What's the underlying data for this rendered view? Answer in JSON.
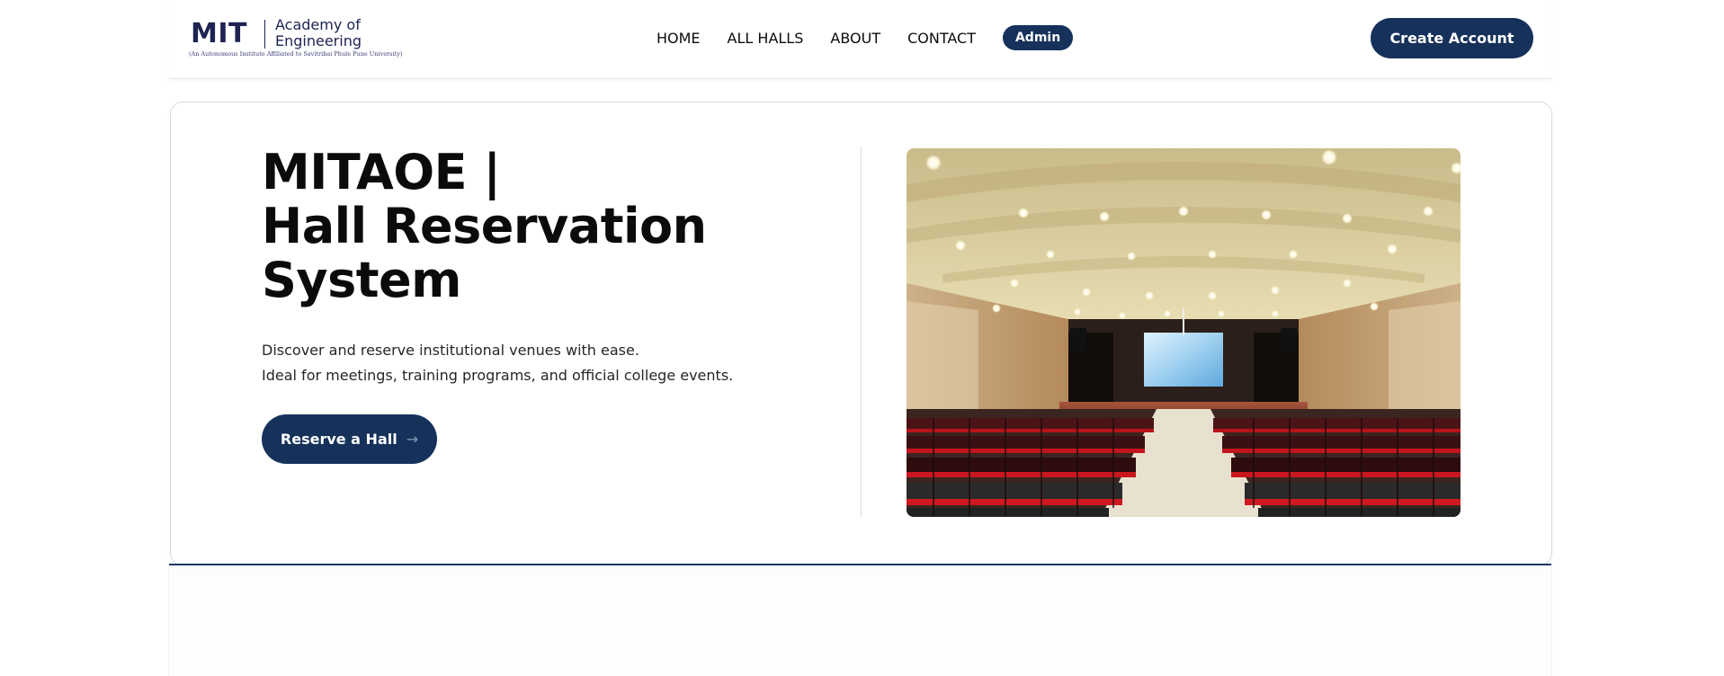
{
  "header": {
    "logo": {
      "mark": "MIT",
      "line1": "Academy of",
      "line2": "Engineering",
      "subtitle": "(An Autonomous Institute Affiliated to Savitribai Phule Pune University)"
    },
    "nav": [
      {
        "label": "HOME"
      },
      {
        "label": "ALL HALLS"
      },
      {
        "label": "ABOUT"
      },
      {
        "label": "CONTACT"
      }
    ],
    "admin_label": "Admin",
    "create_account_label": "Create Account"
  },
  "hero": {
    "title_lines": [
      "MITAOE |",
      "Hall Reservation",
      "System"
    ],
    "description_lines": [
      "Discover and reserve institutional venues with ease.",
      "Ideal for meetings, training programs, and official college events."
    ],
    "cta_label": "Reserve a Hall",
    "cta_icon": "arrow-right-icon",
    "image_icon": "auditorium-image"
  },
  "colors": {
    "primary": "#16325b",
    "logo": "#1d2352",
    "text": "#0b0b0b",
    "seat_red": "#b8121b"
  }
}
